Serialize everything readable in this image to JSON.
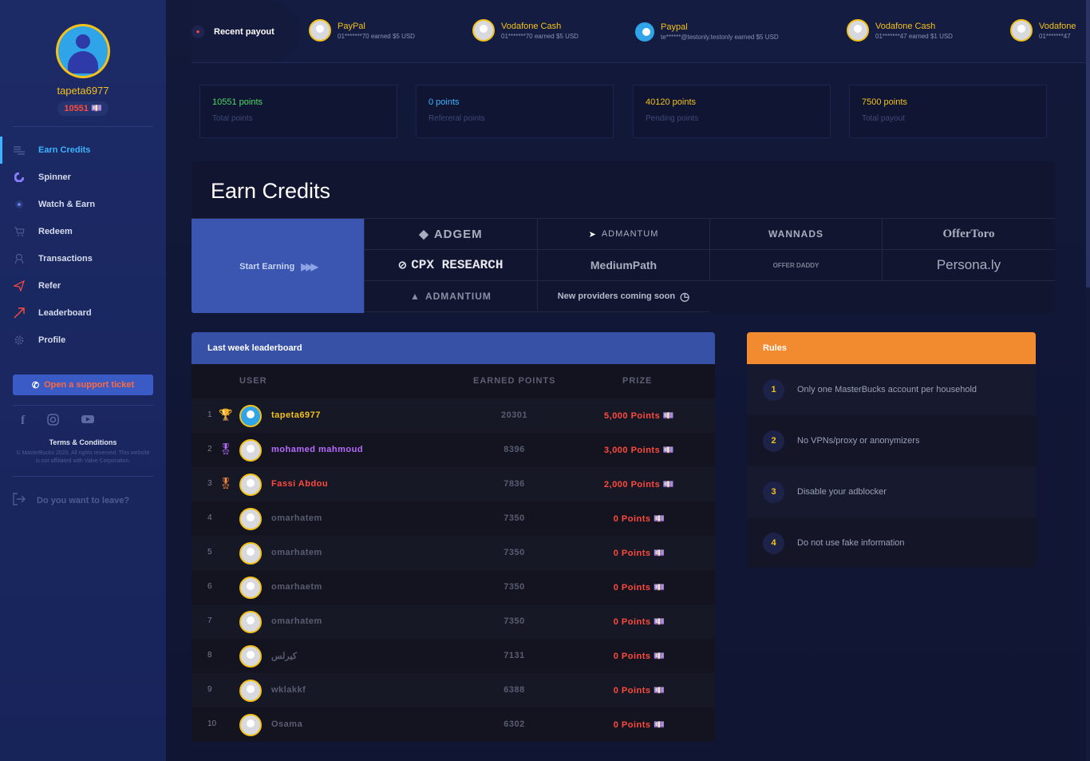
{
  "sidebar": {
    "username": "tapeta6977",
    "balance": "10551 💷",
    "nav": [
      {
        "label": "Earn Credits",
        "icon": "coins-icon",
        "active": true
      },
      {
        "label": "Spinner",
        "icon": "spinner-icon"
      },
      {
        "label": "Watch & Earn",
        "icon": "play-icon"
      },
      {
        "label": "Redeem",
        "icon": "cart-icon"
      },
      {
        "label": "Transactions",
        "icon": "transactions-icon"
      },
      {
        "label": "Refer",
        "icon": "send-icon"
      },
      {
        "label": "Leaderboard",
        "icon": "trend-icon"
      },
      {
        "label": "Profile",
        "icon": "gear-icon"
      }
    ],
    "support_label": "Open a support ticket",
    "terms": "Terms & Conditions",
    "copyright": "© MasterBucks 2020. All rights reserved. This website is not affiliated with Valve Corporation.",
    "leave": "Do you want to leave?"
  },
  "ticker": {
    "title": "Recent payout",
    "items": [
      {
        "name": "PayPal",
        "desc": "01*******70 earned $5 USD"
      },
      {
        "name": "Vodafone Cash",
        "desc": "01*******70 earned $5 USD"
      },
      {
        "name": "Paypal",
        "desc": "te******@testonly.testonly earned $5 USD"
      },
      {
        "name": "Vodafone Cash",
        "desc": "01*******47 earned $1 USD"
      },
      {
        "name": "Vodafone",
        "desc": "01*******47"
      }
    ]
  },
  "stats": [
    {
      "value": "10551 points",
      "label": "Total points",
      "color": "#4cd964"
    },
    {
      "value": "0 points",
      "label": "Refereral points",
      "color": "#3db4ff"
    },
    {
      "value": "40120 points",
      "label": "Pending points",
      "color": "#f2c21b"
    },
    {
      "value": "7500 points",
      "label": "Total payout",
      "color": "#f2c21b"
    }
  ],
  "earn": {
    "title": "Earn Credits",
    "start_label": "Start Earning",
    "providers": [
      "ADGEM",
      "ADMANTUM",
      "WANNADS",
      "OfferToro",
      "CPX RESEARCH",
      "MediumPath",
      "OFFER DADDY",
      "Persona.ly",
      "ADMANTIUM",
      "New providers coming soon"
    ]
  },
  "leaderboard": {
    "title": "Last week leaderboard",
    "columns": {
      "user": "USER",
      "earned": "EARNED POINTS",
      "prize": "PRIZE"
    },
    "rows": [
      {
        "rank": "1",
        "user": "tapeta6977",
        "points": "20301",
        "prize": "5,000 Points 💷",
        "color": "#f2c21b"
      },
      {
        "rank": "2",
        "user": "mohamed mahmoud",
        "points": "8396",
        "prize": "3,000 Points 💷",
        "color": "#b56cff"
      },
      {
        "rank": "3",
        "user": "Fassi Abdou",
        "points": "7836",
        "prize": "2,000 Points 💷",
        "color": "#ff4a3d"
      },
      {
        "rank": "4",
        "user": "omarhatem",
        "points": "7350",
        "prize": "0 Points 💷"
      },
      {
        "rank": "5",
        "user": "omarhatem",
        "points": "7350",
        "prize": "0 Points 💷"
      },
      {
        "rank": "6",
        "user": "omarhaetm",
        "points": "7350",
        "prize": "0 Points 💷"
      },
      {
        "rank": "7",
        "user": "omarhatem",
        "points": "7350",
        "prize": "0 Points 💷"
      },
      {
        "rank": "8",
        "user": "كيرلس",
        "points": "7131",
        "prize": "0 Points 💷"
      },
      {
        "rank": "9",
        "user": "wklakkf",
        "points": "6388",
        "prize": "0 Points 💷"
      },
      {
        "rank": "10",
        "user": "Osama",
        "points": "6302",
        "prize": "0 Points 💷"
      }
    ]
  },
  "rules": {
    "title": "Rules",
    "items": [
      {
        "num": "1",
        "text": "Only one MasterBucks account per household"
      },
      {
        "num": "2",
        "text": "No VPNs/proxy or anonymizers"
      },
      {
        "num": "3",
        "text": "Disable your adblocker"
      },
      {
        "num": "4",
        "text": "Do not use fake information"
      }
    ]
  }
}
